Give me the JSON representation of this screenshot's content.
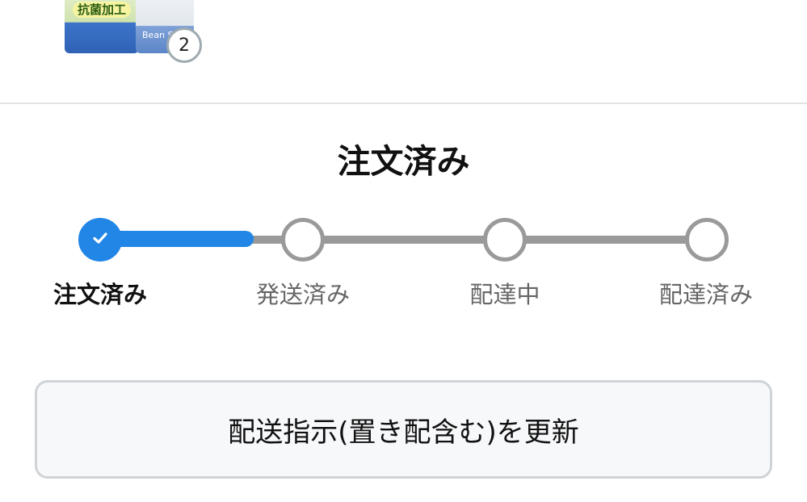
{
  "product": {
    "package_text_main": "抗菌加工",
    "package_text_brand": "Bean S",
    "quantity": "2"
  },
  "order_status": {
    "title": "注文済み",
    "steps": [
      {
        "label": "注文済み",
        "state": "done"
      },
      {
        "label": "発送済み",
        "state": "pending"
      },
      {
        "label": "配達中",
        "state": "pending"
      },
      {
        "label": "配達済み",
        "state": "pending"
      }
    ],
    "progress_percent": 25,
    "colors": {
      "active": "#2186e6",
      "inactive": "#9a9a9a"
    }
  },
  "actions": {
    "update_delivery_label": "配送指示(置き配含む)を更新"
  },
  "icons": {
    "step_done": "check-icon"
  }
}
